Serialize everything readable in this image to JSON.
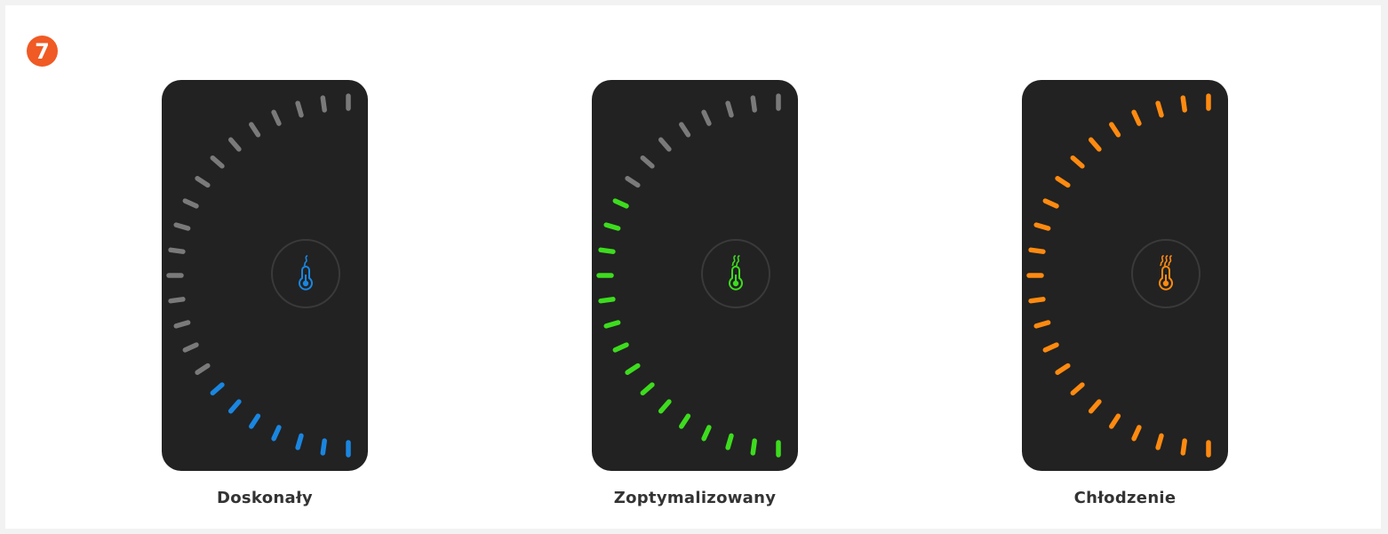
{
  "step": {
    "number": "7",
    "color": "#f05a24"
  },
  "colors": {
    "inactive": "#7a7a7a",
    "device_bg": "#222222",
    "ring": "#3a3a3a"
  },
  "panels": [
    {
      "label": "Doskonały",
      "state_color": "#1a86e0",
      "active_ticks": 7,
      "total_ticks": 23,
      "wave_count": 1,
      "icon": "thermometer-icon"
    },
    {
      "label": "Zoptymalizowany",
      "state_color": "#3ddc1e",
      "active_ticks": 15,
      "total_ticks": 23,
      "wave_count": 2,
      "icon": "thermometer-icon"
    },
    {
      "label": "Chłodzenie",
      "state_color": "#ff8a10",
      "active_ticks": 23,
      "total_ticks": 23,
      "wave_count": 3,
      "icon": "thermometer-icon"
    }
  ]
}
